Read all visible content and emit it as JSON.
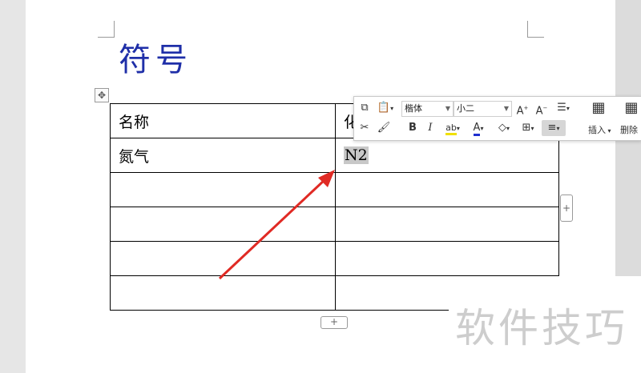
{
  "document": {
    "heading": "符号",
    "table": {
      "rows": [
        [
          "名称",
          "化"
        ],
        [
          "氮气",
          "N2"
        ],
        [
          "",
          ""
        ],
        [
          "",
          ""
        ],
        [
          "",
          ""
        ],
        [
          "",
          ""
        ]
      ]
    }
  },
  "toolbar": {
    "font_name": "楷体",
    "font_size": "小二",
    "insert_label": "插入",
    "delete_label": "删除"
  },
  "watermark": "软件技巧",
  "colors": {
    "heading": "#1f2fa8",
    "arrow": "#e02a24"
  }
}
